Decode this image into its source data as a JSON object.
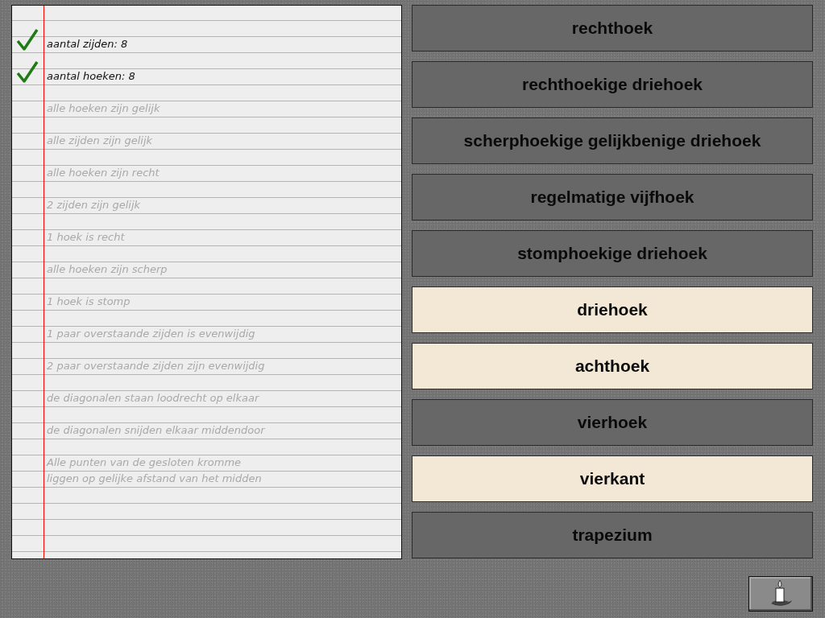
{
  "notebook": {
    "items": [
      {
        "text": "aantal zijden: 8",
        "checked": true
      },
      {
        "text": "aantal hoeken: 8",
        "checked": true
      },
      {
        "text": "alle hoeken zijn gelijk",
        "checked": false
      },
      {
        "text": "alle zijden zijn gelijk",
        "checked": false
      },
      {
        "text": "alle hoeken zijn recht",
        "checked": false
      },
      {
        "text": "2 zijden zijn gelijk",
        "checked": false
      },
      {
        "text": "1 hoek is recht",
        "checked": false
      },
      {
        "text": "alle hoeken zijn scherp",
        "checked": false
      },
      {
        "text": "1 hoek is stomp",
        "checked": false
      },
      {
        "text": "1 paar overstaande zijden is evenwijdig",
        "checked": false
      },
      {
        "text": "2 paar overstaande zijden zijn evenwijdig",
        "checked": false
      },
      {
        "text": "de diagonalen staan loodrecht op elkaar",
        "checked": false
      },
      {
        "text": "de diagonalen snijden elkaar middendoor",
        "checked": false
      },
      {
        "text": "Alle punten van de gesloten kromme\nliggen op gelijke afstand van het midden",
        "checked": false
      }
    ]
  },
  "shapes": [
    {
      "label": "rechthoek",
      "highlighted": false
    },
    {
      "label": "rechthoekige driehoek",
      "highlighted": false
    },
    {
      "label": "scherphoekige gelijkbenige driehoek",
      "highlighted": false
    },
    {
      "label": "regelmatige vijfhoek",
      "highlighted": false
    },
    {
      "label": "stomphoekige driehoek",
      "highlighted": false
    },
    {
      "label": "driehoek",
      "highlighted": true
    },
    {
      "label": "achthoek",
      "highlighted": true
    },
    {
      "label": "vierhoek",
      "highlighted": false
    },
    {
      "label": "vierkant",
      "highlighted": true
    },
    {
      "label": "trapezium",
      "highlighted": false
    }
  ]
}
